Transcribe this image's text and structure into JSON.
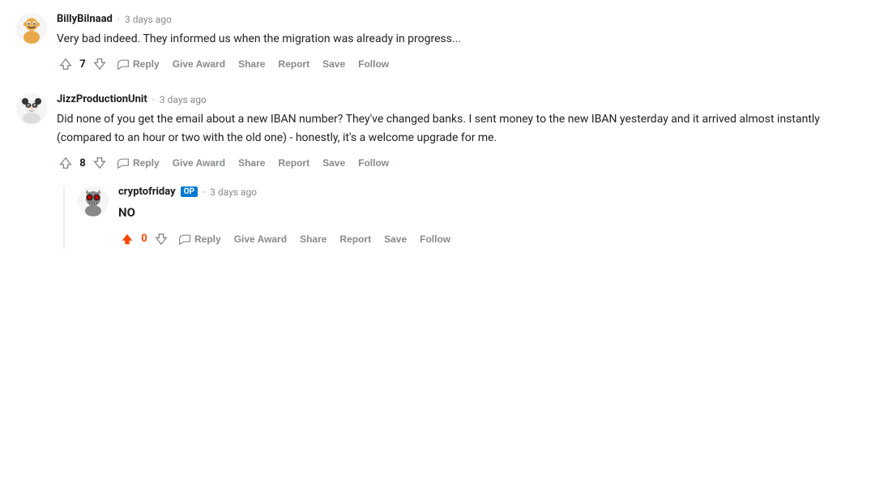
{
  "comments": [
    {
      "id": "comment1",
      "username": "BillyBilnaad",
      "op": false,
      "time": "3 days ago",
      "text": "Very bad indeed. They informed us when the migration was already in progress...",
      "vote_count": "7",
      "upvoted": false,
      "actions": [
        "Reply",
        "Give Award",
        "Share",
        "Report",
        "Save",
        "Follow"
      ]
    },
    {
      "id": "comment2",
      "username": "JizzProductionUnit",
      "op": false,
      "time": "3 days ago",
      "text": "Did none of you get the email about a new IBAN number? They've changed banks. I sent money to the new IBAN yesterday and it arrived almost instantly (compared to an hour or two with the old one) - honestly, it's a welcome upgrade for me.",
      "vote_count": "8",
      "upvoted": false,
      "actions": [
        "Reply",
        "Give Award",
        "Share",
        "Report",
        "Save",
        "Follow"
      ],
      "replies": [
        {
          "id": "reply1",
          "username": "cryptofriday",
          "op": true,
          "time": "3 days ago",
          "text_bold": "NO",
          "vote_count": "0",
          "upvoted": true,
          "actions": [
            "Reply",
            "Give Award",
            "Share",
            "Report",
            "Save",
            "Follow"
          ]
        }
      ]
    }
  ],
  "op_badge_label": "OP",
  "dot_separator": "·"
}
